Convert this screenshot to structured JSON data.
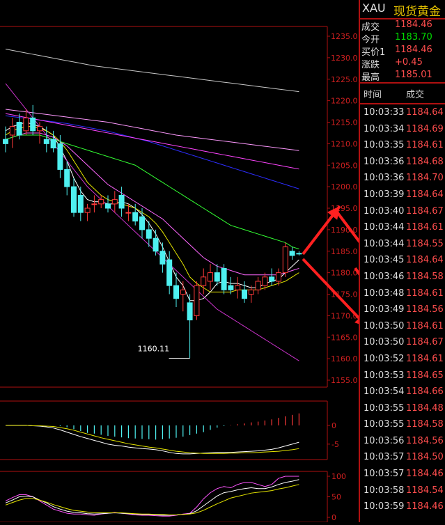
{
  "symbol": "XAU",
  "name": "现货黄金",
  "quote": [
    {
      "label": "成交",
      "value": "1184.46",
      "color": "#ff4d4d"
    },
    {
      "label": "今开",
      "value": "1183.70",
      "color": "#00e000"
    },
    {
      "label": "买价1",
      "value": "1184.46",
      "color": "#ff4d4d"
    },
    {
      "label": "涨跌",
      "value": "+0.45",
      "color": "#ff4d4d"
    },
    {
      "label": "最高",
      "value": "1185.01",
      "color": "#ff4d4d"
    }
  ],
  "ticks_header": {
    "time": "时间",
    "price": "成交"
  },
  "ticks": [
    {
      "time": "10:03:33",
      "price": "1184.64"
    },
    {
      "time": "10:03:34",
      "price": "1184.69"
    },
    {
      "time": "10:03:35",
      "price": "1184.61"
    },
    {
      "time": "10:03:36",
      "price": "1184.68"
    },
    {
      "time": "10:03:36",
      "price": "1184.70"
    },
    {
      "time": "10:03:39",
      "price": "1184.64"
    },
    {
      "time": "10:03:40",
      "price": "1184.67"
    },
    {
      "time": "10:03:44",
      "price": "1184.61"
    },
    {
      "time": "10:03:44",
      "price": "1184.55"
    },
    {
      "time": "10:03:45",
      "price": "1184.64"
    },
    {
      "time": "10:03:46",
      "price": "1184.58"
    },
    {
      "time": "10:03:48",
      "price": "1184.61"
    },
    {
      "time": "10:03:49",
      "price": "1184.56"
    },
    {
      "time": "10:03:50",
      "price": "1184.61"
    },
    {
      "time": "10:03:50",
      "price": "1184.67"
    },
    {
      "time": "10:03:52",
      "price": "1184.61"
    },
    {
      "time": "10:03:53",
      "price": "1184.65"
    },
    {
      "time": "10:03:54",
      "price": "1184.66"
    },
    {
      "time": "10:03:55",
      "price": "1184.48"
    },
    {
      "time": "10:03:55",
      "price": "1184.58"
    },
    {
      "time": "10:03:56",
      "price": "1184.56"
    },
    {
      "time": "10:03:57",
      "price": "1184.50"
    },
    {
      "time": "10:03:57",
      "price": "1184.46"
    },
    {
      "time": "10:03:58",
      "price": "1184.54"
    },
    {
      "time": "10:03:59",
      "price": "1184.46"
    }
  ],
  "chart_data": [
    {
      "type": "candlestick",
      "y_ticks": [
        "1235.0",
        "1230.0",
        "1225.0",
        "1220.0",
        "1215.0",
        "1210.0",
        "1205.0",
        "1200.0",
        "1195.0",
        "1190.0",
        "1185.0",
        "1180.0",
        "1175.0",
        "1170.0",
        "1165.0",
        "1160.0",
        "1155.0"
      ],
      "ylim": [
        1155,
        1235
      ],
      "annotation": "1160.11",
      "ohlc": [
        [
          1211,
          1214,
          1208,
          1210
        ],
        [
          1212,
          1216,
          1209,
          1214
        ],
        [
          1215,
          1217,
          1211,
          1212
        ],
        [
          1213,
          1218,
          1212,
          1216
        ],
        [
          1216,
          1219,
          1212,
          1213
        ],
        [
          1213,
          1215,
          1210,
          1214
        ],
        [
          1211,
          1214,
          1208,
          1210
        ],
        [
          1211,
          1213,
          1208,
          1209
        ],
        [
          1210,
          1212,
          1202,
          1204
        ],
        [
          1204,
          1206,
          1198,
          1200
        ],
        [
          1200,
          1202,
          1193,
          1194
        ],
        [
          1198,
          1200,
          1192,
          1194
        ],
        [
          1194,
          1196,
          1192,
          1195
        ],
        [
          1196,
          1198,
          1194,
          1196
        ],
        [
          1196,
          1198,
          1195,
          1197
        ],
        [
          1196,
          1198,
          1194,
          1195
        ],
        [
          1196,
          1199,
          1194,
          1197
        ],
        [
          1198,
          1200,
          1193,
          1195
        ],
        [
          1194,
          1196,
          1192,
          1194
        ],
        [
          1194,
          1196,
          1191,
          1192
        ],
        [
          1193,
          1195,
          1188,
          1190
        ],
        [
          1190,
          1192,
          1186,
          1188
        ],
        [
          1188,
          1190,
          1184,
          1185
        ],
        [
          1185,
          1187,
          1180,
          1182
        ],
        [
          1183,
          1185,
          1175,
          1177
        ],
        [
          1177,
          1180,
          1172,
          1174
        ],
        [
          1175,
          1178,
          1171,
          1176
        ],
        [
          1173,
          1175,
          1160.11,
          1169
        ],
        [
          1170,
          1178,
          1169,
          1177
        ],
        [
          1177,
          1181,
          1175,
          1179
        ],
        [
          1178,
          1182,
          1176,
          1180
        ],
        [
          1180,
          1182,
          1177,
          1178
        ],
        [
          1181,
          1182,
          1175,
          1176
        ],
        [
          1177,
          1179,
          1175,
          1176
        ],
        [
          1176,
          1179,
          1174,
          1177
        ],
        [
          1176,
          1178,
          1173,
          1174
        ],
        [
          1175,
          1177,
          1173,
          1176
        ],
        [
          1176,
          1179,
          1175,
          1178
        ],
        [
          1177,
          1180,
          1176,
          1179
        ],
        [
          1179,
          1181,
          1177,
          1178
        ],
        [
          1178,
          1181,
          1177,
          1180
        ],
        [
          1180,
          1187,
          1179,
          1186
        ],
        [
          1185,
          1186,
          1183,
          1184
        ],
        [
          1184.5,
          1185,
          1184,
          1184.46
        ]
      ],
      "ma_lines": [
        {
          "color": "#ffffff",
          "values": [
            1213,
            1214,
            1214.5,
            1215,
            1214.5,
            1214,
            1213,
            1212,
            1209,
            1206,
            1202,
            1199,
            1197,
            1196.5,
            1196.5,
            1196,
            1196,
            1196.5,
            1196,
            1195,
            1193.5,
            1191.5,
            1189,
            1186,
            1182.5,
            1179,
            1177,
            1173.5,
            1173.5,
            1174,
            1175.5,
            1177.5,
            1178,
            1177.5,
            1177.5,
            1177,
            1176.5,
            1176.5,
            1177.5,
            1178,
            1178.5,
            1180,
            1181.5,
            1183
          ]
        },
        {
          "color": "#e6e600",
          "values": [
            1212,
            1213,
            1213.5,
            1214,
            1214,
            1213.5,
            1213,
            1212,
            1210.5,
            1208.5,
            1206,
            1203.5,
            1201,
            1199.5,
            1198,
            1197,
            1196.5,
            1196,
            1195.5,
            1195,
            1194,
            1193,
            1191.5,
            1189.5,
            1187,
            1184.5,
            1182,
            1179,
            1177.5,
            1176.5,
            1175.5,
            1175.5,
            1175.5,
            1175.5,
            1176,
            1176,
            1176,
            1176,
            1176.5,
            1177,
            1177.5,
            1178,
            1179,
            1180
          ]
        },
        {
          "color": "#ff66ff",
          "values": [
            1211,
            1211.5,
            1212,
            1212.5,
            1212.5,
            1212.5,
            1212,
            1211.5,
            1210.5,
            1209.5,
            1208,
            1206.5,
            1205,
            1203.5,
            1202,
            1200.5,
            1199.5,
            1198.5,
            1197.5,
            1196.5,
            1195.5,
            1194.5,
            1193.5,
            1192.5,
            1191,
            1189.5,
            1188,
            1186.5,
            1185,
            1183.5,
            1182.5,
            1181.5,
            1181,
            1180.5,
            1180,
            1179.5,
            1179.5,
            1179.5,
            1179.5,
            1179.5,
            1179.5,
            1180,
            1180.5,
            1181
          ]
        },
        {
          "color": "#33ff33",
          "values": [
            1211,
            1211.5,
            1212,
            1212,
            1212,
            1212,
            1211.5,
            1211,
            1210.5,
            1210,
            1209.5,
            1209,
            1208.5,
            1208,
            1207.5,
            1207,
            1206.5,
            1206,
            1205.5,
            1205,
            1204,
            1203,
            1202,
            1201,
            1200,
            1199,
            1198,
            1197,
            1196,
            1195,
            1194,
            1193,
            1192,
            1191,
            1190.5,
            1190,
            1189.5,
            1189,
            1188.5,
            1188,
            1187.5,
            1187,
            1186,
            1185.5
          ]
        },
        {
          "color": "#2d2dff",
          "values": [
            1216.5,
            1216.3,
            1216.1,
            1215.9,
            1215.7,
            1215.5,
            1215.3,
            1215.1,
            1214.9,
            1214.7,
            1214.4,
            1214.1,
            1213.8,
            1213.5,
            1213.2,
            1212.9,
            1212.5,
            1212.1,
            1211.7,
            1211.3,
            1210.9,
            1210.5,
            1210,
            1209.5,
            1209,
            1208.5,
            1208,
            1207.5,
            1207,
            1206.5,
            1206,
            1205.5,
            1205,
            1204.5,
            1204,
            1203.5,
            1203,
            1202.5,
            1202,
            1201.5,
            1201,
            1200.5,
            1200,
            1199.5
          ]
        },
        {
          "color": "#ff99ff",
          "values": [
            1218,
            1217.8,
            1217.6,
            1217.4,
            1217.2,
            1217,
            1216.8,
            1216.6,
            1216.4,
            1216.2,
            1216,
            1215.8,
            1215.6,
            1215.4,
            1215.2,
            1215,
            1214.7,
            1214.4,
            1214.1,
            1213.8,
            1213.5,
            1213.2,
            1212.9,
            1212.6,
            1212.3,
            1212,
            1211.8,
            1211.6,
            1211.4,
            1211.2,
            1211,
            1210.8,
            1210.6,
            1210.4,
            1210.2,
            1210,
            1209.8,
            1209.6,
            1209.4,
            1209.2,
            1209,
            1208.8,
            1208.6,
            1208.4
          ]
        },
        {
          "color": "#ff44ff",
          "values": [
            1217,
            1216.7,
            1216.4,
            1216.1,
            1215.8,
            1215.5,
            1215.2,
            1214.9,
            1214.6,
            1214.3,
            1214,
            1213.7,
            1213.4,
            1213.1,
            1212.8,
            1212.5,
            1212.2,
            1211.9,
            1211.6,
            1211.3,
            1211,
            1210.7,
            1210.4,
            1210.1,
            1209.8,
            1209.5,
            1209.2,
            1208.9,
            1208.6,
            1208.3,
            1208,
            1207.7,
            1207.4,
            1207.1,
            1206.8,
            1206.5,
            1206.2,
            1205.9,
            1205.6,
            1205.3,
            1205,
            1204.7,
            1204.4,
            1204.1
          ]
        },
        {
          "color": "#c8c8c8",
          "values": [
            1232,
            1231.7,
            1231.4,
            1231.1,
            1230.8,
            1230.5,
            1230.2,
            1229.9,
            1229.6,
            1229.3,
            1229,
            1228.7,
            1228.4,
            1228.1,
            1227.9,
            1227.7,
            1227.5,
            1227.3,
            1227.1,
            1226.9,
            1226.7,
            1226.5,
            1226.3,
            1226.1,
            1225.9,
            1225.7,
            1225.5,
            1225.3,
            1225.1,
            1224.9,
            1224.7,
            1224.5,
            1224.3,
            1224.1,
            1223.9,
            1223.7,
            1223.5,
            1223.3,
            1223.1,
            1222.9,
            1222.7,
            1222.5,
            1222.3,
            1222.1
          ]
        },
        {
          "color": "#cc33cc",
          "values": [
            1224,
            1222,
            1220,
            1218,
            1216,
            1214,
            1212,
            1210,
            1208,
            1206,
            1204,
            1202,
            1200,
            1198.5,
            1197,
            1195.5,
            1194,
            1192.5,
            1191,
            1189.5,
            1188,
            1186.5,
            1185,
            1183.5,
            1182,
            1180.5,
            1179,
            1177.5,
            1176,
            1174.5,
            1173,
            1171.5,
            1170.5,
            1169.5,
            1168.5,
            1167.5,
            1166.5,
            1165.5,
            1164.5,
            1163.5,
            1162.5,
            1161.5,
            1160.5,
            1159.5
          ]
        }
      ]
    },
    {
      "type": "bar",
      "y_ticks": [
        "0",
        "-5"
      ],
      "ylim": [
        -8,
        5
      ],
      "values": [
        0,
        0,
        0,
        0,
        0,
        0,
        0,
        0,
        -0.2,
        -0.5,
        -1,
        -1.5,
        -2,
        -2.2,
        -2.5,
        -2.8,
        -3,
        -3.2,
        -3.4,
        -3.5,
        -3.6,
        -3.7,
        -3.8,
        -3.7,
        -3.5,
        -3.3,
        -3,
        -2.6,
        -2.2,
        -1.8,
        -1.2,
        -0.6,
        -0.2,
        0.1,
        0.3,
        0.5,
        0.8,
        1,
        1.3,
        1.6,
        2,
        2.4,
        2.8,
        3.2
      ],
      "lines": [
        {
          "color": "#ffffff",
          "values": [
            0,
            0,
            0,
            0,
            -0.1,
            -0.2,
            -0.4,
            -0.7,
            -1.2,
            -1.8,
            -2.4,
            -3,
            -3.5,
            -4,
            -4.5,
            -5,
            -5.3,
            -5.5,
            -5.8,
            -6,
            -6.2,
            -6.3,
            -6.5,
            -6.8,
            -7.2,
            -7.5,
            -7.6,
            -7.6,
            -7.5,
            -7.4,
            -7.3,
            -7.2,
            -7.2,
            -7.2,
            -7.1,
            -7,
            -6.9,
            -6.8,
            -6.6,
            -6.4,
            -6,
            -5.5,
            -5,
            -4.5
          ]
        },
        {
          "color": "#e6e600",
          "values": [
            0,
            0,
            0,
            0,
            -0.1,
            -0.1,
            -0.2,
            -0.3,
            -0.6,
            -0.9,
            -1.3,
            -1.8,
            -2.3,
            -2.8,
            -3.3,
            -3.7,
            -4.1,
            -4.5,
            -4.9,
            -5.2,
            -5.5,
            -5.8,
            -6,
            -6.3,
            -6.6,
            -6.9,
            -7.1,
            -7.3,
            -7.4,
            -7.5,
            -7.5,
            -7.5,
            -7.5,
            -7.4,
            -7.4,
            -7.3,
            -7.3,
            -7.2,
            -7.1,
            -7,
            -6.9,
            -6.7,
            -6.5,
            -6.2
          ]
        }
      ]
    },
    {
      "type": "line",
      "y_ticks": [
        "100",
        "50",
        "0"
      ],
      "ylim": [
        0,
        100
      ],
      "lines": [
        {
          "color": "#ff55ff",
          "values": [
            40,
            48,
            55,
            55,
            50,
            40,
            30,
            20,
            15,
            10,
            8,
            8,
            6,
            5,
            8,
            10,
            12,
            10,
            8,
            6,
            5,
            5,
            4,
            3,
            3,
            5,
            8,
            10,
            25,
            45,
            60,
            70,
            75,
            72,
            80,
            85,
            85,
            80,
            75,
            80,
            95,
            100,
            100,
            100
          ]
        },
        {
          "color": "#ffffff",
          "values": [
            35,
            42,
            50,
            52,
            50,
            42,
            35,
            26,
            20,
            15,
            12,
            11,
            9,
            8,
            9,
            10,
            11,
            10,
            9,
            8,
            7,
            7,
            6,
            5,
            5,
            6,
            7,
            9,
            16,
            28,
            40,
            52,
            60,
            63,
            67,
            70,
            72,
            70,
            70,
            74,
            80,
            85,
            88,
            92
          ]
        },
        {
          "color": "#e6e600",
          "values": [
            30,
            36,
            42,
            46,
            46,
            42,
            37,
            31,
            26,
            21,
            17,
            15,
            13,
            11,
            11,
            11,
            11,
            11,
            10,
            9,
            8,
            8,
            7,
            7,
            6,
            6,
            7,
            8,
            11,
            17,
            25,
            33,
            40,
            47,
            51,
            55,
            59,
            61,
            63,
            65,
            69,
            72,
            76,
            80
          ]
        }
      ]
    }
  ]
}
